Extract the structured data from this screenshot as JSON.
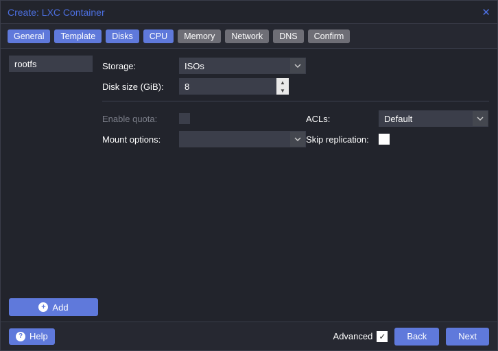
{
  "window": {
    "title": "Create: LXC Container"
  },
  "tabs": [
    "General",
    "Template",
    "Disks",
    "CPU",
    "Memory",
    "Network",
    "DNS",
    "Confirm"
  ],
  "active_tabs": [
    0,
    1,
    2,
    3
  ],
  "selected_tab": 2,
  "sidebar": {
    "items": [
      "rootfs"
    ]
  },
  "form": {
    "storage_label": "Storage:",
    "storage_value": "ISOs",
    "disk_size_label": "Disk size (GiB):",
    "disk_size_value": "8",
    "enable_quota_label": "Enable quota:",
    "mount_options_label": "Mount options:",
    "mount_options_value": "",
    "acls_label": "ACLs:",
    "acls_value": "Default",
    "skip_replication_label": "Skip replication:"
  },
  "buttons": {
    "add": "Add",
    "help": "Help",
    "advanced": "Advanced",
    "back": "Back",
    "next": "Next"
  }
}
